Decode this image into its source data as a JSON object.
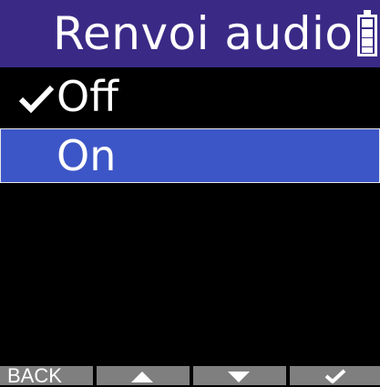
{
  "header": {
    "title": "Renvoi audio",
    "battery_icon": "battery-full-icon"
  },
  "menu": {
    "items": [
      {
        "label": "Off",
        "checked": true,
        "selected": false
      },
      {
        "label": "On",
        "checked": false,
        "selected": true
      }
    ]
  },
  "footer": {
    "back_label": "BACK",
    "up_icon": "up-arrow-icon",
    "down_icon": "down-arrow-icon",
    "confirm_icon": "checkmark-icon"
  },
  "colors": {
    "header_bg": "#3a2a86",
    "selected_bg": "#3d56c7",
    "footer_button": "#7f7f7f",
    "background": "#000000",
    "text": "#ffffff"
  }
}
